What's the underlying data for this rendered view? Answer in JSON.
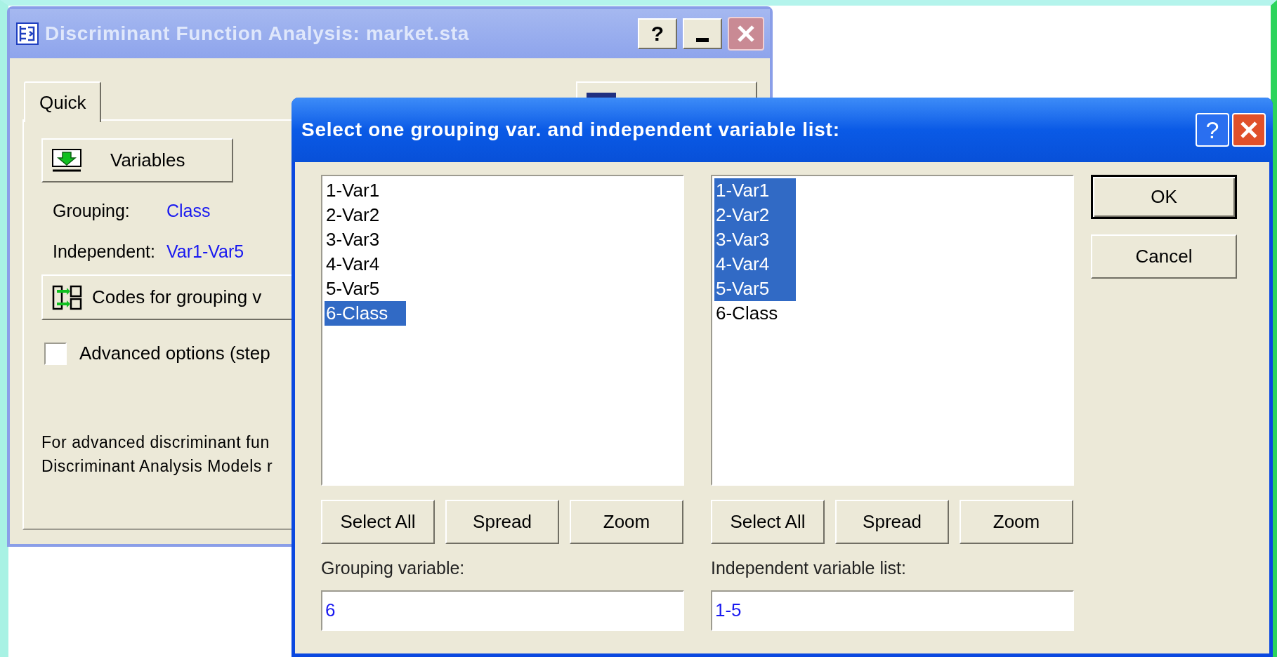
{
  "main_window": {
    "title": "Discriminant Function Analysis: market.sta",
    "help_button": "?",
    "tabs": [
      {
        "label": "Quick",
        "selected": true
      }
    ],
    "variables_button": "Variables",
    "fields": [
      {
        "label": "Grouping:",
        "value": "Class"
      },
      {
        "label": "Independent:",
        "value": "Var1-Var5"
      }
    ],
    "codes_button": "Codes for grouping v",
    "advanced_checkbox": {
      "label": "Advanced options (step",
      "checked": false
    },
    "note_lines": [
      "For advanced discriminant fun",
      "Discriminant Analysis Models r"
    ]
  },
  "dialog": {
    "title": "Select one grouping var. and independent variable list:",
    "help_button": "?",
    "lists": [
      {
        "items": [
          {
            "label": "1-Var1",
            "selected": false
          },
          {
            "label": "2-Var2",
            "selected": false
          },
          {
            "label": "3-Var3",
            "selected": false
          },
          {
            "label": "4-Var4",
            "selected": false
          },
          {
            "label": "5-Var5",
            "selected": false
          },
          {
            "label": "6-Class",
            "selected": true
          }
        ],
        "buttons": [
          "Select All",
          "Spread",
          "Zoom"
        ],
        "field_label": "Grouping variable:",
        "value": "6"
      },
      {
        "items": [
          {
            "label": "1-Var1",
            "selected": true
          },
          {
            "label": "2-Var2",
            "selected": true
          },
          {
            "label": "3-Var3",
            "selected": true
          },
          {
            "label": "4-Var4",
            "selected": true
          },
          {
            "label": "5-Var5",
            "selected": true
          },
          {
            "label": "6-Class",
            "selected": false
          }
        ],
        "buttons": [
          "Select All",
          "Spread",
          "Zoom"
        ],
        "field_label": "Independent variable list:",
        "value": "1-5"
      }
    ],
    "buttons": [
      "OK",
      "Cancel"
    ]
  }
}
